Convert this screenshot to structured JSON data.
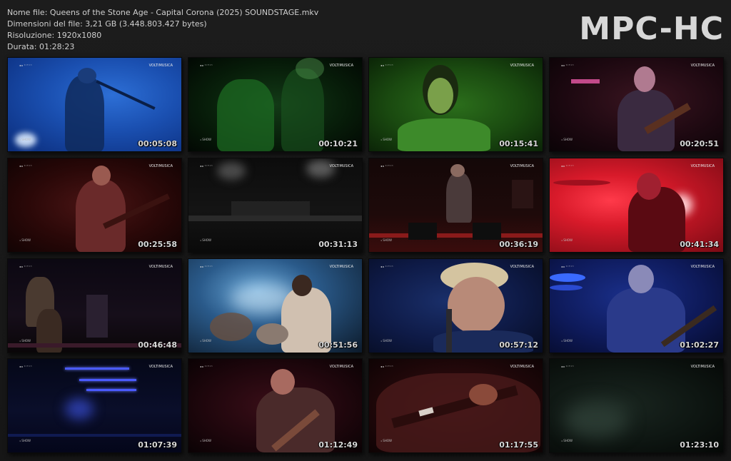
{
  "info": {
    "filename": "Nome file: Queens of the Stone Age - Capital Corona (2025) SOUNDSTAGE.mkv",
    "filesize": "Dimensioni del file: 3,21 GB (3.448.803.427 bytes)",
    "resolution": "Risoluzione: 1920x1080",
    "duration": "Durata: 01:28:23"
  },
  "brand": "MPC-HC",
  "thumbnails": [
    {
      "time": "00:05:08",
      "wm_left": "◂◂ ᵃᶜᵗⁱᵒⁿ",
      "wm_right": "VOLTIMUSICA",
      "wm_bottom": "◃ SHOW"
    },
    {
      "time": "00:10:21",
      "wm_left": "◂◂ ᵃᶜᵗⁱᵒⁿ",
      "wm_right": "VOLTIMUSICA",
      "wm_bottom": "◃ SHOW"
    },
    {
      "time": "00:15:41",
      "wm_left": "◂◂ ᵃᶜᵗⁱᵒⁿ",
      "wm_right": "VOLTIMUSICA",
      "wm_bottom": "◃ SHOW"
    },
    {
      "time": "00:20:51",
      "wm_left": "◂◂ ᵃᶜᵗⁱᵒⁿ",
      "wm_right": "VOLTIMUSICA",
      "wm_bottom": "◃ SHOW"
    },
    {
      "time": "00:25:58",
      "wm_left": "◂◂ ᵃᶜᵗⁱᵒⁿ",
      "wm_right": "VOLTIMUSICA",
      "wm_bottom": "◃ SHOW"
    },
    {
      "time": "00:31:13",
      "wm_left": "◂◂ ᵃᶜᵗⁱᵒⁿ",
      "wm_right": "VOLTIMUSICA",
      "wm_bottom": "◃ SHOW"
    },
    {
      "time": "00:36:19",
      "wm_left": "◂◂ ᵃᶜᵗⁱᵒⁿ",
      "wm_right": "VOLTIMUSICA",
      "wm_bottom": "◃ SHOW"
    },
    {
      "time": "00:41:34",
      "wm_left": "◂◂ ᵃᶜᵗⁱᵒⁿ",
      "wm_right": "VOLTIMUSICA",
      "wm_bottom": "◃ SHOW"
    },
    {
      "time": "00:46:48",
      "wm_left": "◂◂ ᵃᶜᵗⁱᵒⁿ",
      "wm_right": "VOLTIMUSICA",
      "wm_bottom": "◃ SHOW"
    },
    {
      "time": "00:51:56",
      "wm_left": "◂◂ ᵃᶜᵗⁱᵒⁿ",
      "wm_right": "VOLTIMUSICA",
      "wm_bottom": "◃ SHOW"
    },
    {
      "time": "00:57:12",
      "wm_left": "◂◂ ᵃᶜᵗⁱᵒⁿ",
      "wm_right": "VOLTIMUSICA",
      "wm_bottom": "◃ SHOW"
    },
    {
      "time": "01:02:27",
      "wm_left": "◂◂ ᵃᶜᵗⁱᵒⁿ",
      "wm_right": "VOLTIMUSICA",
      "wm_bottom": "◃ SHOW"
    },
    {
      "time": "01:07:39",
      "wm_left": "◂◂ ᵃᶜᵗⁱᵒⁿ",
      "wm_right": "VOLTIMUSICA",
      "wm_bottom": "◃ SHOW"
    },
    {
      "time": "01:12:49",
      "wm_left": "◂◂ ᵃᶜᵗⁱᵒⁿ",
      "wm_right": "VOLTIMUSICA",
      "wm_bottom": "◃ SHOW"
    },
    {
      "time": "01:17:55",
      "wm_left": "◂◂ ᵃᶜᵗⁱᵒⁿ",
      "wm_right": "VOLTIMUSICA",
      "wm_bottom": "◃ SHOW"
    },
    {
      "time": "01:23:10",
      "wm_left": "◂◂ ᵃᶜᵗⁱᵒⁿ",
      "wm_right": "VOLTIMUSICA",
      "wm_bottom": "◃ SHOW"
    }
  ]
}
